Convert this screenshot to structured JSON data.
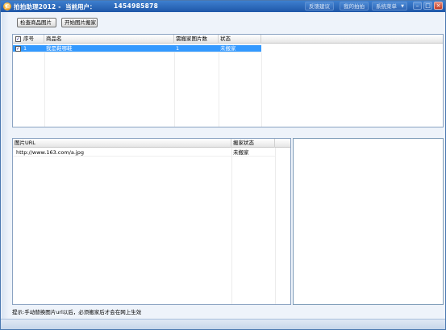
{
  "titlebar": {
    "app_title": "拍拍助理2012 -",
    "user_label": "当前用户：",
    "user_id": "1454985878",
    "links": [
      "反馈建议",
      "我的拍拍",
      "系统菜单"
    ],
    "minimize": "–",
    "maximize": "□",
    "close": "×",
    "app_icon_char": "拍"
  },
  "toolbar": {
    "check_button": "检查商品图片",
    "move_button": "开始图片搬家"
  },
  "products_table": {
    "columns": [
      "序号",
      "商品名",
      "需搬家图片数",
      "状态"
    ],
    "header_checked": true,
    "rows": [
      {
        "checked": true,
        "index": "1",
        "name": "我是鞋哪鞋",
        "count": "1",
        "status": "未搬家"
      }
    ]
  },
  "images_table": {
    "columns": [
      "图片URL",
      "搬家状态"
    ],
    "rows": [
      {
        "url": "http://www.163.com/a.jpg",
        "status": "未搬家"
      }
    ]
  },
  "status_bar": {
    "tip": "提示:手动替换图片url以后，必须搬家后才会在网上生效"
  },
  "colors": {
    "title_bg": "#2a66b8",
    "selected_row": "#3399ff",
    "window_bg": "#eef3fa"
  }
}
